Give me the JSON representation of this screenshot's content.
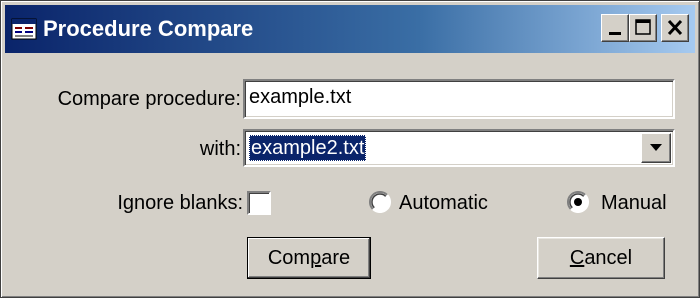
{
  "window": {
    "title": "Procedure Compare",
    "icon": "app-icon",
    "caption_buttons": [
      "minimize-icon",
      "maximize-icon",
      "close-icon"
    ]
  },
  "form": {
    "compare_label": "Compare procedure:",
    "compare_value": "example.txt",
    "with_label": "with:",
    "with_value": "example2.txt",
    "ignore_blanks_label": "Ignore blanks:",
    "ignore_blanks_checked": false,
    "radio_automatic_label": "Automatic",
    "radio_manual_label": "Manual",
    "radio_selected": "Manual"
  },
  "buttons": {
    "compare_pre": "Com",
    "compare_underline": "p",
    "compare_post": "are",
    "cancel_underline": "C",
    "cancel_post": "ancel"
  },
  "colors": {
    "titlebar_start": "#0a246a",
    "titlebar_end": "#a6caf0",
    "face": "#d4d0c8",
    "selection": "#0a246a"
  }
}
